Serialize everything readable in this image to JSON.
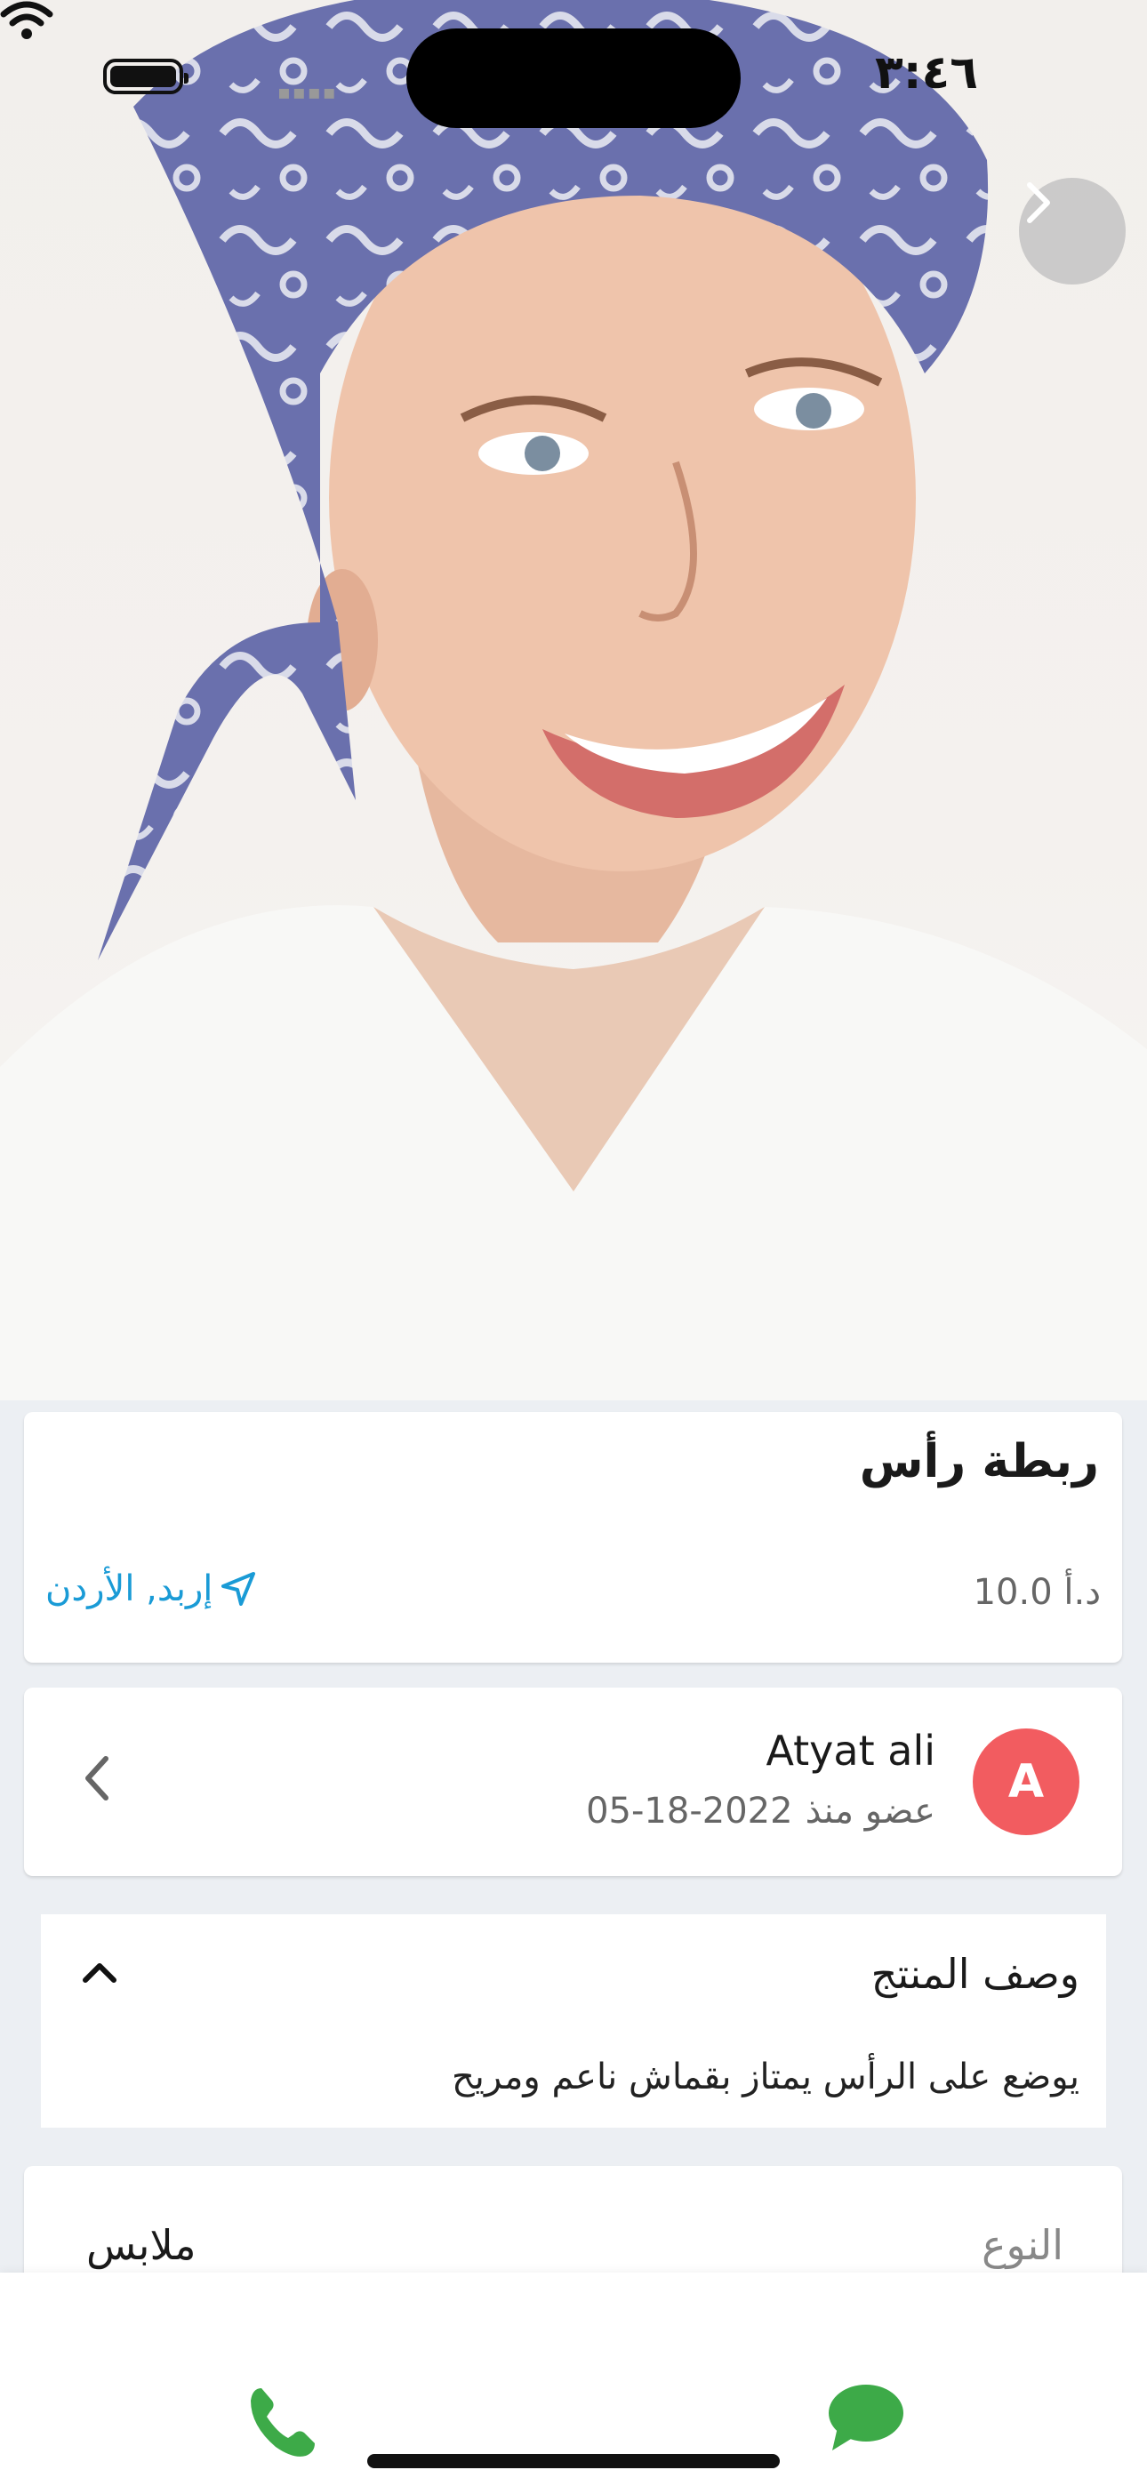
{
  "status_bar": {
    "time": "٣:٤٦"
  },
  "product": {
    "title": "ربطة رأس",
    "price": "10.0 د.أ",
    "location": "إربد, الأردن"
  },
  "seller": {
    "avatar_letter": "A",
    "name": "Atyat ali",
    "member_label": "عضو منذ",
    "member_date": "05-18-2022"
  },
  "description": {
    "title": "وصف المنتج",
    "text": "يوضع على الرأس يمتاز بقماش ناعم ومريح"
  },
  "details": {
    "type_label": "النوع",
    "type_value": "ملابس"
  },
  "colors": {
    "accent_blue": "#1a9bd6",
    "avatar_red": "#f25c60",
    "action_green": "#3daa48"
  }
}
